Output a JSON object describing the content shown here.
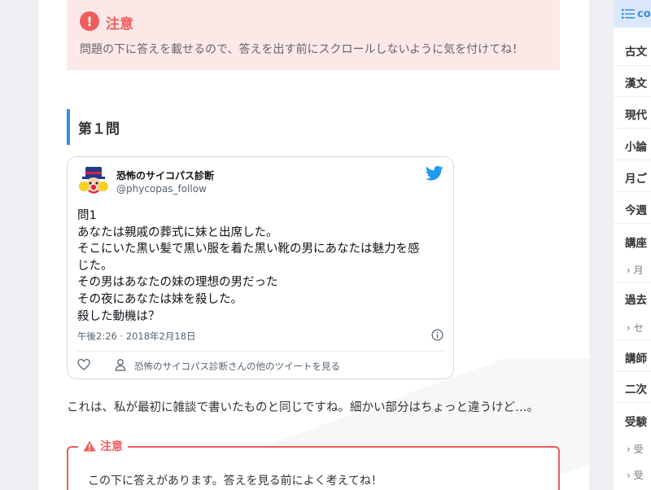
{
  "notice": {
    "icon": "exclamation-circle-icon",
    "title": "注意",
    "text": "問題の下に答えを載せるので、答えを出す前にスクロールしないように気を付けてね！"
  },
  "heading": "第１問",
  "tweet": {
    "name": "恐怖のサイコパス診断",
    "handle": "@phycopas_follow",
    "lines": [
      "問1",
      "あなたは親戚の葬式に妹と出席した。",
      "そこにいた黒い髪で黒い服を着た黒い靴の男にあなたは魅力を感",
      "じた。",
      "その男はあなたの妹の理想の男だった",
      "その夜にあなたは妹を殺した。",
      "殺した動機は？"
    ],
    "meta": "午後2:26 · 2018年2月18日",
    "more_link": "恐怖のサイコパス診断さんの他のツイートを見る",
    "brand_color": "#1d9bf0"
  },
  "paragraph": "これは、私が最初に雑談で書いたものと同じですね。細かい部分はちょっと違うけど…。",
  "warning": {
    "title": "注意",
    "text": "この下に答えがあります。答えを見る前によく考えてね！"
  },
  "sidebar": {
    "header": "co",
    "items": [
      {
        "label": "古文",
        "type": "item"
      },
      {
        "label": "漢文",
        "type": "item"
      },
      {
        "label": "現代",
        "type": "item"
      },
      {
        "label": "小論",
        "type": "item"
      },
      {
        "label": "月ご",
        "type": "item"
      },
      {
        "label": "今週",
        "type": "item"
      },
      {
        "label": "講座",
        "type": "item"
      },
      {
        "label": "月",
        "type": "sub"
      },
      {
        "label": "過去",
        "type": "item"
      },
      {
        "label": "セ",
        "type": "sub"
      },
      {
        "label": "講師",
        "type": "item"
      },
      {
        "label": "二次",
        "type": "item"
      },
      {
        "label": "受験",
        "type": "item"
      },
      {
        "label": "受",
        "type": "sub"
      },
      {
        "label": "受",
        "type": "sub"
      }
    ]
  },
  "colors": {
    "accent_blue": "#3a8ee6",
    "alert_red": "#ee5c5c",
    "notice_bg": "#fde8e8"
  }
}
